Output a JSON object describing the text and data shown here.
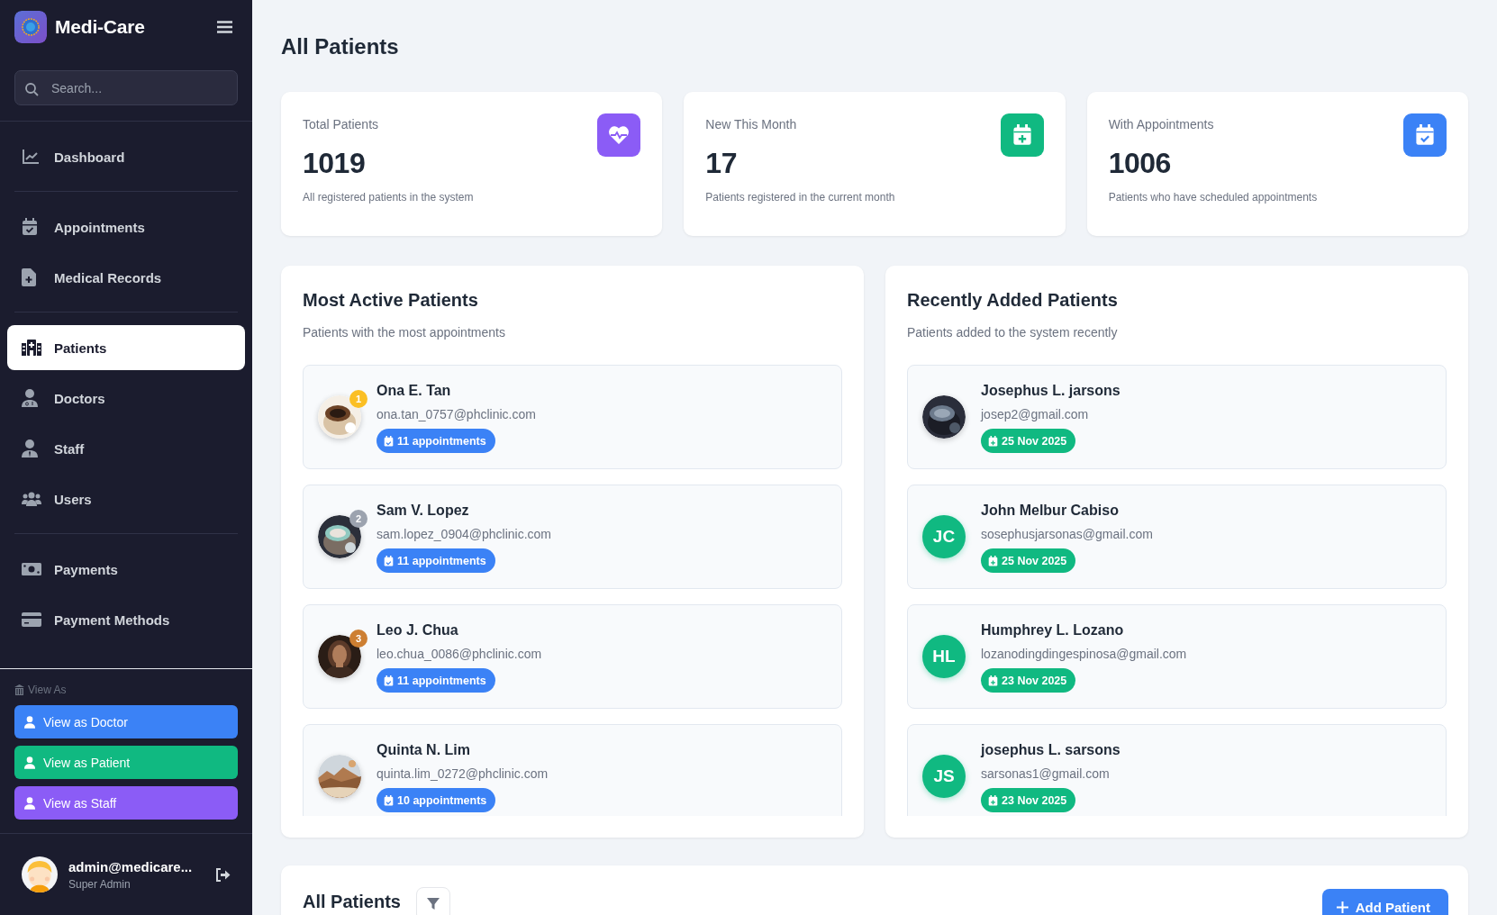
{
  "app": {
    "name": "Medi-Care"
  },
  "search": {
    "placeholder": "Search..."
  },
  "nav_sections": [
    {
      "items": [
        {
          "label": "Dashboard",
          "selected": false
        }
      ]
    },
    {
      "items": [
        {
          "label": "Appointments",
          "selected": false
        },
        {
          "label": "Medical Records",
          "selected": false
        }
      ]
    },
    {
      "items": [
        {
          "label": "Patients",
          "selected": true
        },
        {
          "label": "Doctors",
          "selected": false
        },
        {
          "label": "Staff",
          "selected": false
        },
        {
          "label": "Users",
          "selected": false
        }
      ]
    },
    {
      "items": [
        {
          "label": "Payments",
          "selected": false
        },
        {
          "label": "Payment Methods",
          "selected": false
        }
      ]
    }
  ],
  "view_as": {
    "label": "View As",
    "buttons": [
      {
        "label": "View as Doctor",
        "color": "#3b82f6"
      },
      {
        "label": "View as Patient",
        "color": "#10b981"
      },
      {
        "label": "View as Staff",
        "color": "#8b5cf6"
      }
    ]
  },
  "user": {
    "name": "admin@medicare...",
    "role": "Super Admin"
  },
  "page_title": "All Patients",
  "stats": [
    {
      "label": "Total Patients",
      "value": "1019",
      "description": "All registered patients in the system",
      "color": "#8b5cf6"
    },
    {
      "label": "New This Month",
      "value": "17",
      "description": "Patients registered in the current month",
      "color": "#10b981"
    },
    {
      "label": "With Appointments",
      "value": "1006",
      "description": "Patients who have scheduled appointments",
      "color": "#3b82f6"
    }
  ],
  "most_active": {
    "title": "Most Active Patients",
    "subtitle": "Patients with the most appointments",
    "patients": [
      {
        "name": "Ona E. Tan",
        "email": "ona.tan_0757@phclinic.com",
        "badge": "11 appointments",
        "rank": "1",
        "color": "#fbbf24"
      },
      {
        "name": "Sam V. Lopez",
        "email": "sam.lopez_0904@phclinic.com",
        "badge": "11 appointments",
        "rank": "2",
        "color": "#9ca3af"
      },
      {
        "name": "Leo J. Chua",
        "email": "leo.chua_0086@phclinic.com",
        "badge": "11 appointments",
        "rank": "3",
        "color": "#cd7f32"
      },
      {
        "name": "Quinta N. Lim",
        "email": "quinta.lim_0272@phclinic.com",
        "badge": "10 appointments"
      }
    ]
  },
  "recently_added": {
    "title": "Recently Added Patients",
    "subtitle": "Patients added to the system recently",
    "patients": [
      {
        "name": "Josephus L. jarsons",
        "email": "josep2@gmail.com",
        "badge": "25 Nov 2025"
      },
      {
        "name": "John Melbur Cabiso",
        "email": "sosephusjarsonas@gmail.com",
        "badge": "25 Nov 2025",
        "avatar": {
          "kind": "initials",
          "initials": "JC"
        }
      },
      {
        "name": "Humphrey L. Lozano",
        "email": "lozanodingdingespinosa@gmail.com",
        "badge": "23 Nov 2025",
        "avatar": {
          "kind": "initials",
          "initials": "HL"
        }
      },
      {
        "name": "josephus L. sarsons",
        "email": "sarsonas1@gmail.com",
        "badge": "23 Nov 2025",
        "avatar": {
          "kind": "initials",
          "initials": "JS"
        }
      }
    ]
  },
  "patients_table": {
    "title": "All Patients",
    "add_button": "Add Patient"
  }
}
